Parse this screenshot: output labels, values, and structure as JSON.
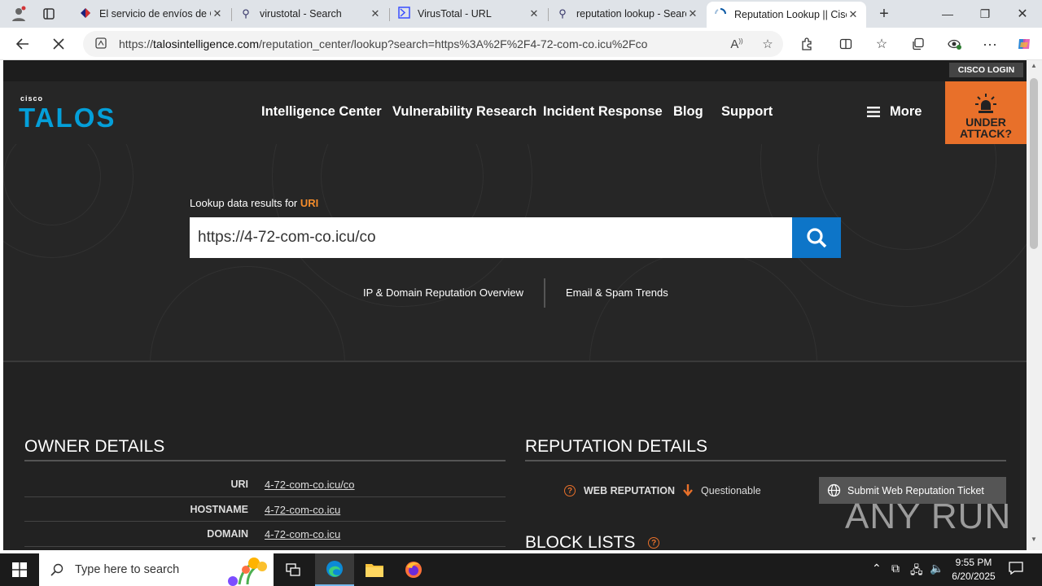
{
  "browser": {
    "tabs": [
      {
        "title": "El servicio de envíos de C",
        "icon": "shield-icon"
      },
      {
        "title": "virustotal - Search",
        "icon": "search-icon"
      },
      {
        "title": "VirusTotal - URL",
        "icon": "virustotal-icon"
      },
      {
        "title": "reputation lookup - Searc",
        "icon": "search-icon"
      },
      {
        "title": "Reputation Lookup || Cisc",
        "icon": "loading-icon"
      }
    ],
    "url_prefix": "https://",
    "url_host": "talosintelligence.com",
    "url_path": "/reputation_center/lookup?search=https%3A%2F%2F4-72-com-co.icu%2Fco"
  },
  "site": {
    "cisco_login": "CISCO LOGIN",
    "logo_small": "cisco",
    "logo_big": "TALOS",
    "nav": [
      "Intelligence Center",
      "Vulnerability Research",
      "Incident Response",
      "Blog",
      "Support"
    ],
    "more": "More",
    "under_attack": [
      "UNDER",
      "ATTACK?"
    ]
  },
  "hero": {
    "label": "Lookup data results for",
    "kind": "URI",
    "query": "https://4-72-com-co.icu/co",
    "link1": "IP & Domain Reputation Overview",
    "link2": "Email & Spam Trends"
  },
  "owner": {
    "title": "OWNER DETAILS",
    "rows": [
      {
        "label": "URI",
        "value": "4-72-com-co.icu/co"
      },
      {
        "label": "HOSTNAME",
        "value": "4-72-com-co.icu"
      },
      {
        "label": "DOMAIN",
        "value": "4-72-com-co.icu"
      }
    ]
  },
  "reputation": {
    "title": "REPUTATION DETAILS",
    "web_label": "WEB REPUTATION",
    "web_value": "Questionable",
    "ticket": "Submit Web Reputation Ticket",
    "blocklists": "BLOCK LISTS"
  },
  "watermark": "ANY RUN",
  "taskbar": {
    "search_placeholder": "Type here to search",
    "time": "9:55 PM",
    "date": "6/20/2025"
  },
  "colors": {
    "accent": "#f48c2b",
    "talos_blue": "#049fd9",
    "search_blue": "#0d75c8",
    "attack_orange": "#e8702a"
  }
}
